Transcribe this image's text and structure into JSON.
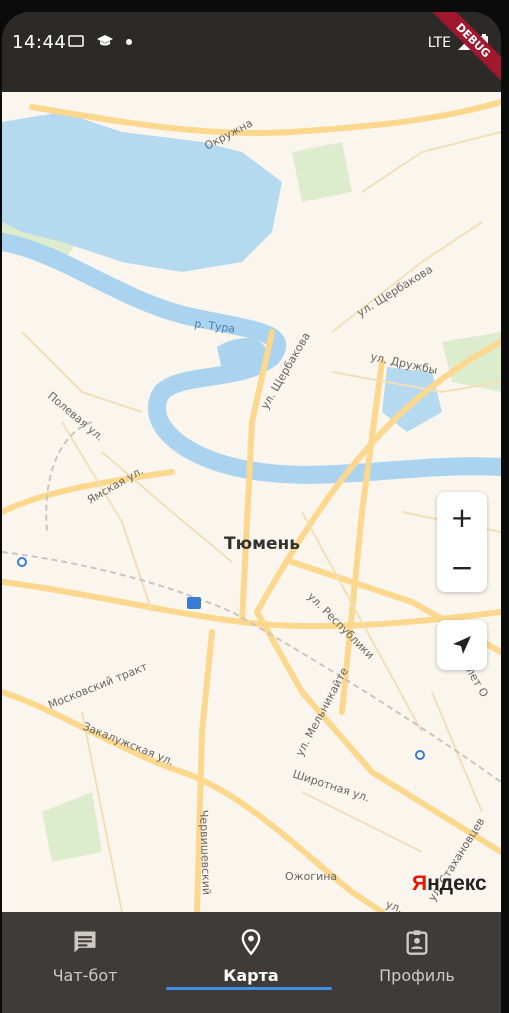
{
  "status_bar": {
    "time": "14:44",
    "network": "LTE",
    "debug_label": "DEBUG"
  },
  "map": {
    "city_label": "Тюмень",
    "street_labels": {
      "okruzhnaya": "Окружна",
      "river": "р. Тура",
      "scherbakova1": "ул. Щербакова",
      "scherbakova2": "ул. Щербакова",
      "druzhby": "ул. Дружбы",
      "polevaya": "Полевая ул.",
      "yamskaya": "Ямская ул.",
      "respubliki": "ул. Республики",
      "let50": "ул. 50 лет О",
      "moskovsky": "Московский тракт",
      "zakaluzhskaya": "Закалужская ул.",
      "melnikaite": "ул. Мельникайте",
      "shirotnaya": "Широтная ул.",
      "chervishevsky": "Червишевский",
      "ozhogina": "Ожогина",
      "stakhanovtsev": "ул. Стахановцев",
      "ul_bottom": "ул."
    },
    "zoom_in_label": "+",
    "zoom_out_label": "−",
    "locate_icon": "navigation-arrow-icon",
    "attribution_y": "Я",
    "attribution_rest": "ндекс"
  },
  "bottom_nav": {
    "items": [
      {
        "label": "Чат-бот",
        "icon": "chat-icon",
        "active": false
      },
      {
        "label": "Карта",
        "icon": "location-pin-icon",
        "active": true
      },
      {
        "label": "Профиль",
        "icon": "profile-badge-icon",
        "active": false
      }
    ],
    "active_color": "#3f8ee8"
  }
}
